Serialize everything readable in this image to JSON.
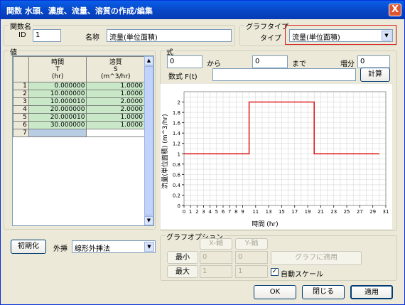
{
  "window": {
    "title": "関数  水頭、濃度、流量、溶質の作成/編集",
    "close": "X"
  },
  "function_group": {
    "title": "関数名",
    "id_label": "ID",
    "id_value": "1",
    "name_label": "名称",
    "name_value": "流量(単位面積)"
  },
  "graph_type_group": {
    "title": "グラフタイプ",
    "type_label": "タイプ",
    "type_value": "流量(単位面積)"
  },
  "values_group": {
    "title": "値",
    "col_time": [
      "時間",
      "T",
      "(hr)"
    ],
    "col_solute": [
      "溶質",
      "S",
      "(m^3/hr)"
    ],
    "rows": [
      {
        "n": "1",
        "t": "0.000000",
        "s": "1.0000"
      },
      {
        "n": "2",
        "t": "10.000000",
        "s": "1.0000"
      },
      {
        "n": "3",
        "t": "10.000010",
        "s": "2.0000"
      },
      {
        "n": "4",
        "t": "20.000000",
        "s": "2.0000"
      },
      {
        "n": "5",
        "t": "20.000010",
        "s": "1.0000"
      },
      {
        "n": "6",
        "t": "30.000000",
        "s": "1.0000"
      },
      {
        "n": "7",
        "t": "",
        "s": ""
      }
    ]
  },
  "formula_group": {
    "title": "式",
    "from_value": "0",
    "from_label": "から",
    "to_value": "0",
    "to_label": "まで",
    "step_label": "増分",
    "step_value": "0",
    "expr_label": "数式 F(t)",
    "expr_value": "",
    "calc_button": "計算"
  },
  "chart_data": {
    "type": "line",
    "x": [
      0,
      10,
      10.00001,
      20,
      20.00001,
      30
    ],
    "y": [
      1,
      1,
      2,
      2,
      1,
      1
    ],
    "xlabel": "時間 (hr)",
    "ylabel": "流量(単位面積) (m^3/hr)",
    "xlim": [
      0,
      31
    ],
    "ylim": [
      0,
      2.2
    ],
    "xticks": [
      0,
      1,
      2,
      3,
      4,
      5,
      6,
      7,
      8,
      9,
      11,
      13,
      15,
      17,
      19,
      21,
      23,
      25,
      27,
      29,
      31
    ],
    "yticks": [
      "0",
      "0.2",
      "0.4",
      "0.6",
      "0.8",
      "1",
      "1.2",
      "1.4",
      "1.6",
      "1.8",
      "2"
    ],
    "grid": true,
    "color": "#e02020"
  },
  "bottom": {
    "init_button": "初期化",
    "extrap_label": "外挿",
    "extrap_value": "線形外挿法"
  },
  "graph_options": {
    "title": "グラフオプション",
    "x_axis": "X-軸",
    "y_axis": "Y-軸",
    "min_label": "最小",
    "max_label": "最大",
    "min_x": "0",
    "min_y": "0",
    "max_x": "1",
    "max_y": "1",
    "apply_graph_button": "グラフに適用",
    "auto_scale_label": "自動スケール",
    "auto_scale_checked": "✓"
  },
  "actions": {
    "ok": "OK",
    "close": "閉じる",
    "apply": "適用"
  }
}
